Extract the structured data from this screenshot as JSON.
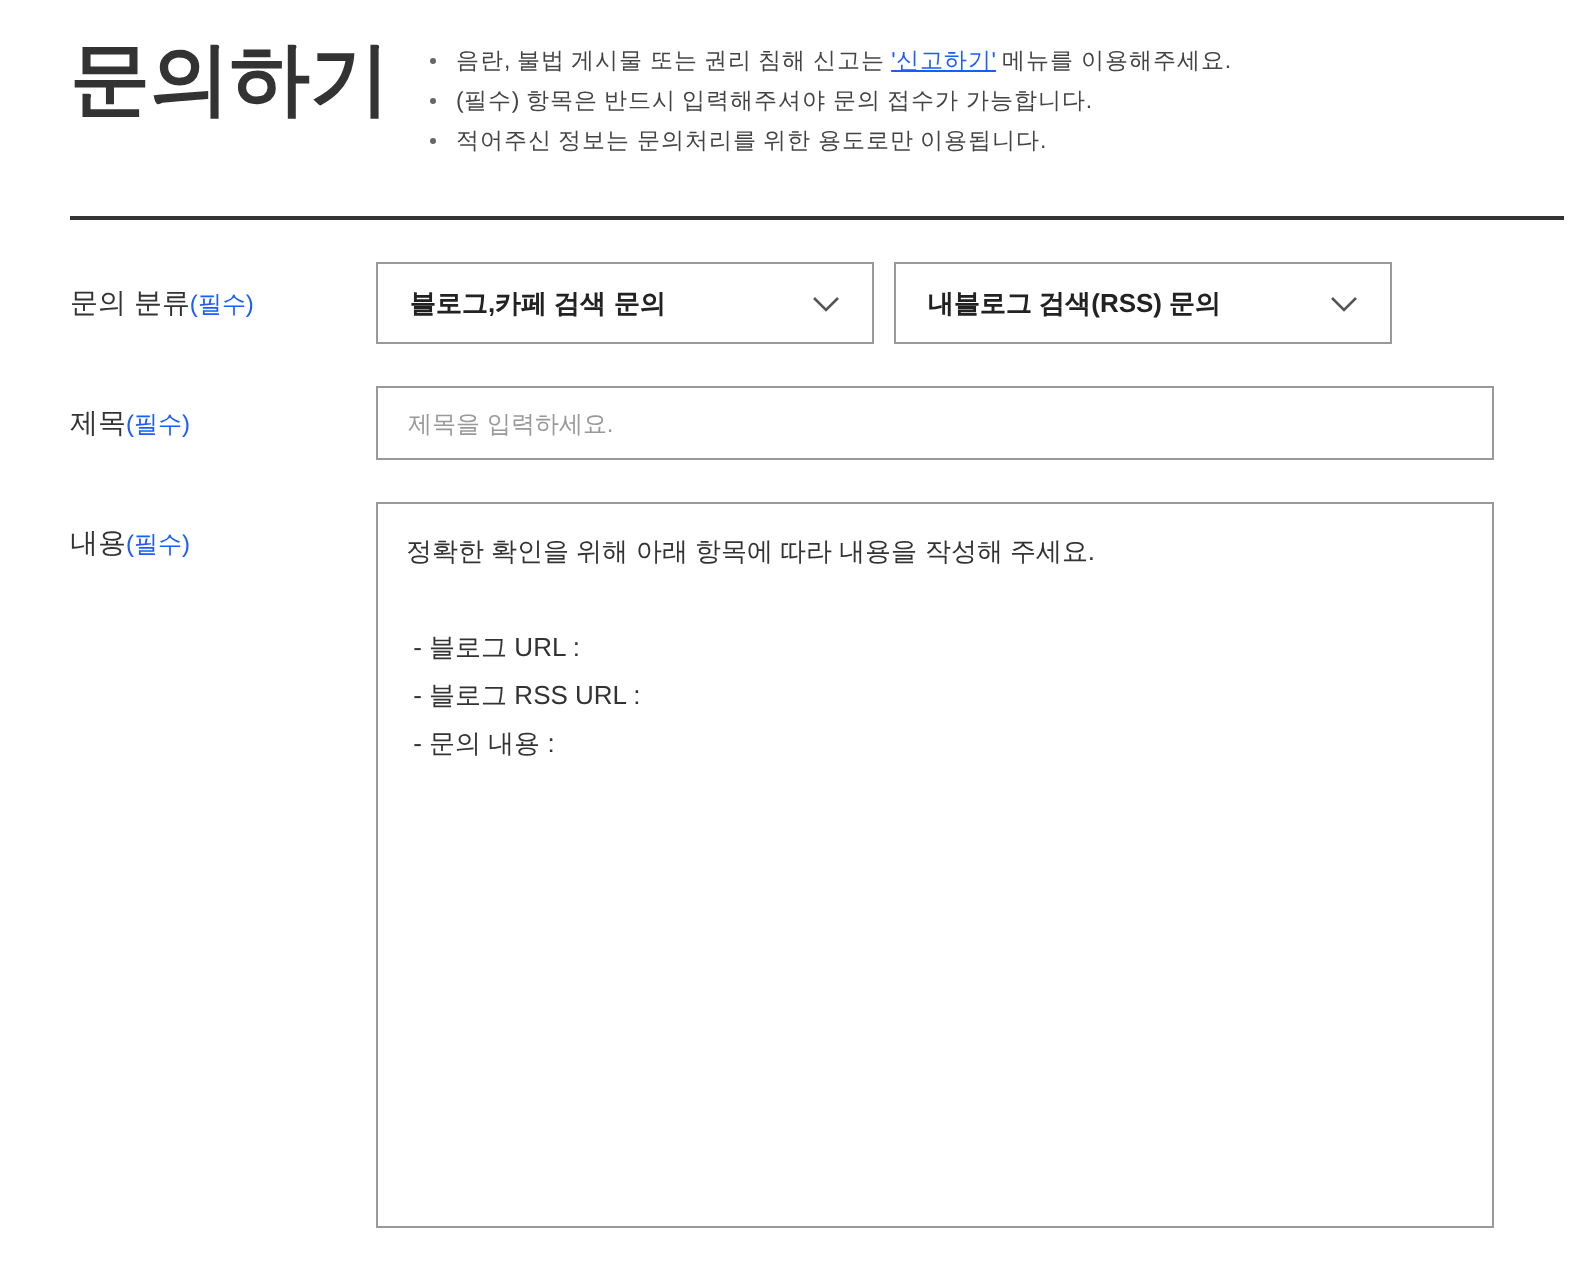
{
  "title": "문의하기",
  "notes": [
    {
      "before": "음란, 불법 게시물 또는 권리 침해 신고는 ",
      "link": "'신고하기'",
      "after": " 메뉴를 이용해주세요."
    },
    {
      "before": "(필수) 항목은 반드시 입력해주셔야 문의 접수가 가능합니다."
    },
    {
      "before": "적어주신 정보는 문의처리를 위한 용도로만 이용됩니다."
    }
  ],
  "form": {
    "category": {
      "label": "문의 분류",
      "required": "(필수)",
      "selects": [
        "블로그,카페 검색 문의",
        "내블로그 검색(RSS) 문의"
      ]
    },
    "subject": {
      "label": "제목",
      "required": "(필수)",
      "placeholder": "제목을 입력하세요."
    },
    "content": {
      "label": "내용",
      "required": "(필수)",
      "intro": "정확한 확인을 위해 아래 항목에 따라 내용을 작성해 주세요.",
      "items": [
        " - 블로그 URL :",
        " - 블로그 RSS URL :",
        " - 문의 내용 :"
      ]
    }
  }
}
